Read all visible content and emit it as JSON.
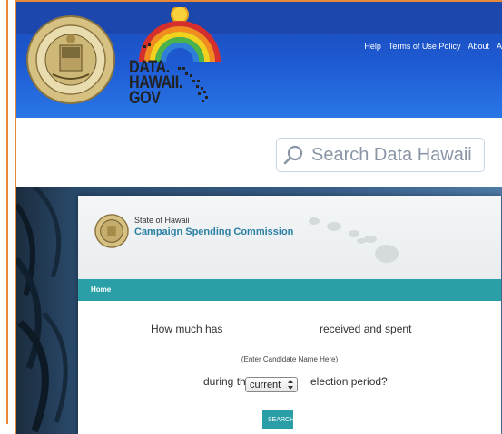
{
  "header": {
    "logo_lines": [
      "DATA.",
      "HAWAII.",
      "GOV"
    ],
    "nav": [
      "Help",
      "Terms of Use Policy",
      "About",
      "Al"
    ]
  },
  "search": {
    "placeholder": "Search Data Hawaii"
  },
  "embed": {
    "agency_state": "State of Hawaii",
    "agency_name": "Campaign Spending Commission",
    "nav_home": "Home",
    "question_part1": "How much has",
    "question_part2": "received and spent",
    "candidate_hint": "(Enter Candidate Name Here)",
    "question_part3": "during the",
    "question_part4": "election period?",
    "period_selected": "current",
    "search_button": "SEARCH"
  },
  "colors": {
    "header_blue": "#1e5bd3",
    "teal": "#2b9fa8",
    "frame_orange": "#e8893a",
    "title_blue": "#2a7fa3"
  },
  "icons": {
    "search": "magnifier-icon",
    "seal": "state-seal-icon",
    "logo": "rainbow-islands-logo"
  }
}
